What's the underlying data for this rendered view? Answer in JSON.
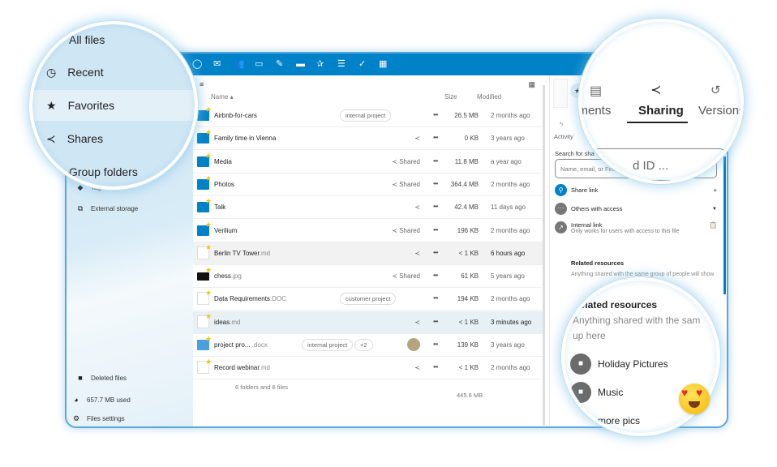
{
  "header": {
    "apps": [
      "search-icon",
      "mail-icon",
      "contacts-icon",
      "calendar-icon",
      "notes-icon",
      "deck-icon",
      "activity-icon",
      "tasks-icon",
      "check-icon",
      "tables-icon"
    ]
  },
  "sidebar": {
    "zoomed_items": [
      {
        "label": "All files",
        "icon": "folder-icon"
      },
      {
        "label": "Recent",
        "icon": "clock-icon"
      },
      {
        "label": "Favorites",
        "icon": "star-icon"
      },
      {
        "label": "Shares",
        "icon": "share-icon"
      },
      {
        "label": "Group folders",
        "icon": "group-folder-icon"
      }
    ],
    "tags": "Tags",
    "external_storage": "External storage",
    "deleted_files": "Deleted files",
    "usage": "657.7 MB used",
    "settings": "Files settings"
  },
  "list": {
    "col_name": "Name",
    "col_size": "Size",
    "col_modified": "Modified",
    "rows": [
      {
        "name": "Airbnb-for-cars",
        "ext": "",
        "type": "group-folder",
        "tags": [
          "internal project"
        ],
        "share": "",
        "size": "26.5 MB",
        "modified": "2 months ago"
      },
      {
        "name": "Family time in Vienna",
        "ext": "",
        "type": "folder",
        "share": "icon",
        "size": "0 KB",
        "modified": "3 years ago"
      },
      {
        "name": "Media",
        "ext": "",
        "type": "shared-folder",
        "share": "Shared",
        "size": "11.8 MB",
        "modified": "a year ago"
      },
      {
        "name": "Photos",
        "ext": "",
        "type": "link-folder",
        "share": "Shared",
        "size": "364.4 MB",
        "modified": "2 months ago"
      },
      {
        "name": "Talk",
        "ext": "",
        "type": "folder",
        "share": "icon",
        "size": "42.4 MB",
        "modified": "11 days ago"
      },
      {
        "name": "Verilium",
        "ext": "",
        "type": "shared-folder",
        "share": "Shared",
        "size": "196 KB",
        "modified": "2 months ago"
      },
      {
        "name": "Berlin TV Tower",
        "ext": ".md",
        "type": "doc",
        "share": "icon",
        "size": "< 1 KB",
        "modified": "6 hours ago",
        "state": "hover"
      },
      {
        "name": "chess",
        "ext": ".jpg",
        "type": "img",
        "share": "Shared",
        "size": "61 KB",
        "modified": "5 years ago"
      },
      {
        "name": "Data Requirements",
        "ext": ".DOC",
        "type": "doc",
        "tags": [
          "customer project"
        ],
        "share": "",
        "size": "194 KB",
        "modified": "2 months ago"
      },
      {
        "name": "ideas",
        "ext": ".md",
        "type": "doc",
        "share": "icon",
        "size": "< 1 KB",
        "modified": "3 minutes ago",
        "state": "selected"
      },
      {
        "name": "project pro...",
        "ext": " .docx",
        "type": "word",
        "tags": [
          "internal project",
          "+2"
        ],
        "share": "avatar",
        "size": "139 KB",
        "modified": "3 years ago"
      },
      {
        "name": "Record webinar",
        "ext": ".md",
        "type": "doc",
        "share": "icon",
        "size": "< 1 KB",
        "modified": "2 months ago"
      }
    ],
    "summary": "6 folders and 6 files",
    "total_size": "445.6 MB"
  },
  "details": {
    "tab_activity": "Activity",
    "tab_comments": "mments",
    "tab_sharing": "Sharing",
    "tab_versions": "Versions",
    "search_label": "Search for sha",
    "search_placeholder": "Name, email, or Fed ID ...",
    "share_link": "Share link",
    "others": "Others with access",
    "internal_link": "Internal link",
    "internal_desc": "Only works for users with access to this file",
    "related_title": "Related resources",
    "related_desc": "Anything shared with the same group of people will show",
    "zoom_related_desc_1": "Anything shared with the sam",
    "zoom_related_desc_2": "up here",
    "resources": [
      "Holiday Pictures",
      "Music",
      "more pics"
    ]
  },
  "colors": {
    "brand": "#0082c9",
    "star": "#f5c400"
  }
}
